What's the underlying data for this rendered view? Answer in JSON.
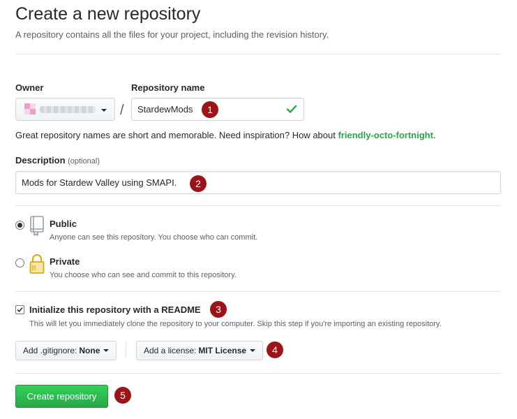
{
  "header": {
    "title": "Create a new repository",
    "subtitle": "A repository contains all the files for your project, including the revision history."
  },
  "owner": {
    "label": "Owner"
  },
  "repo": {
    "label": "Repository name",
    "value": "StardewMods",
    "hint_prefix": "Great repository names are short and memorable. Need inspiration? How about ",
    "suggestion": "friendly-octo-fortnight",
    "hint_suffix": "."
  },
  "description": {
    "label": "Description",
    "optional": "(optional)",
    "value": "Mods for Stardew Valley using SMAPI."
  },
  "visibility": {
    "public": {
      "title": "Public",
      "note": "Anyone can see this repository. You choose who can commit.",
      "selected": true
    },
    "private": {
      "title": "Private",
      "note": "You choose who can see and commit to this repository.",
      "selected": false
    }
  },
  "readme": {
    "label": "Initialize this repository with a README",
    "note": "This will let you immediately clone the repository to your computer. Skip this step if you're importing an existing repository.",
    "checked": true
  },
  "gitignore": {
    "prefix": "Add .gitignore:",
    "value": "None"
  },
  "license": {
    "prefix": "Add a license:",
    "value": "MIT License"
  },
  "submit": {
    "label": "Create repository"
  },
  "annotations": [
    "1",
    "2",
    "3",
    "4",
    "5"
  ],
  "colors": {
    "accent_green": "#28a745",
    "badge_red": "#9b1418",
    "check_green": "#28a745"
  }
}
